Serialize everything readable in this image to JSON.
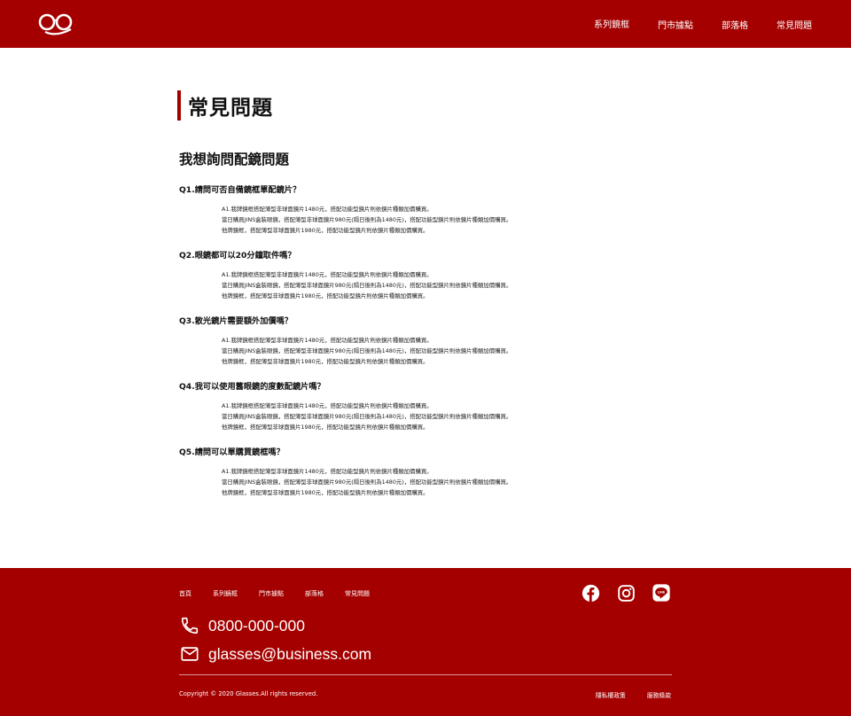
{
  "header": {
    "logo": "glasses-logo",
    "nav": [
      "系列鏡框",
      "門市據點",
      "部落格",
      "常見問題"
    ]
  },
  "page": {
    "title": "常見問題",
    "section_title": "我想詢問配鏡問題"
  },
  "faqs": [
    {
      "q": "Q1.請問可否自備鏡框單配鏡片？",
      "a": [
        "A1.我牌鏡框搭配薄型非球面鏡片1480元，搭配功能型鏡片則依鏡片種類加價購買。",
        "當日購買JINS盒裝眼鏡，搭配薄型非球面鏡片980元(隔日後則為1480元)，搭配功能型鏡片則依鏡片種類加價購買。",
        "他牌鏡框，搭配薄型非球面鏡片1980元，搭配功能型鏡片則依鏡片種類加價購買。"
      ]
    },
    {
      "q": "Q2.眼鏡都可以20分鐘取件嗎？",
      "a": [
        "A1.我牌鏡框搭配薄型非球面鏡片1480元，搭配功能型鏡片則依鏡片種類加價購買。",
        "當日購買JINS盒裝眼鏡，搭配薄型非球面鏡片980元(隔日後則為1480元)，搭配功能型鏡片則依鏡片種類加價購買。",
        "他牌鏡框，搭配薄型非球面鏡片1980元，搭配功能型鏡片則依鏡片種類加價購買。"
      ]
    },
    {
      "q": "Q3.散光鏡片需要額外加價嗎？",
      "a": [
        "A1.我牌鏡框搭配薄型非球面鏡片1480元，搭配功能型鏡片則依鏡片種類加價購買。",
        "當日購買JINS盒裝眼鏡，搭配薄型非球面鏡片980元(隔日後則為1480元)，搭配功能型鏡片則依鏡片種類加價購買。",
        "他牌鏡框，搭配薄型非球面鏡片1980元，搭配功能型鏡片則依鏡片種類加價購買。"
      ]
    },
    {
      "q": "Q4.我可以使用舊眼鏡的度數配鏡片嗎？",
      "a": [
        "A1.我牌鏡框搭配薄型非球面鏡片1480元，搭配功能型鏡片則依鏡片種類加價購買。",
        "當日購買JINS盒裝眼鏡，搭配薄型非球面鏡片980元(隔日後則為1480元)，搭配功能型鏡片則依鏡片種類加價購買。",
        "他牌鏡框，搭配薄型非球面鏡片1980元，搭配功能型鏡片則依鏡片種類加價購買。"
      ]
    },
    {
      "q": "Q5.請問可以單購買鏡框嗎？",
      "a": [
        "A1.我牌鏡框搭配薄型非球面鏡片1480元，搭配功能型鏡片則依鏡片種類加價購買。",
        "當日購買JINS盒裝眼鏡，搭配薄型非球面鏡片980元(隔日後則為1480元)，搭配功能型鏡片則依鏡片種類加價購買。",
        "他牌鏡框，搭配薄型非球面鏡片1980元，搭配功能型鏡片則依鏡片種類加價購買。"
      ]
    }
  ],
  "footer": {
    "nav": [
      "首頁",
      "系列鏡框",
      "門市據點",
      "部落格",
      "常見問題"
    ],
    "social": [
      "facebook-icon",
      "instagram-icon",
      "line-icon"
    ],
    "phone": "0800-000-000",
    "email": "glasses@business.com",
    "copyright": "Copyright © 2020 Glasses.All rights reserved.",
    "legal": [
      "隱私權政策",
      "服務條款"
    ]
  },
  "colors": {
    "brand": "#a50000",
    "text": "#111111",
    "background": "#ffffff"
  }
}
